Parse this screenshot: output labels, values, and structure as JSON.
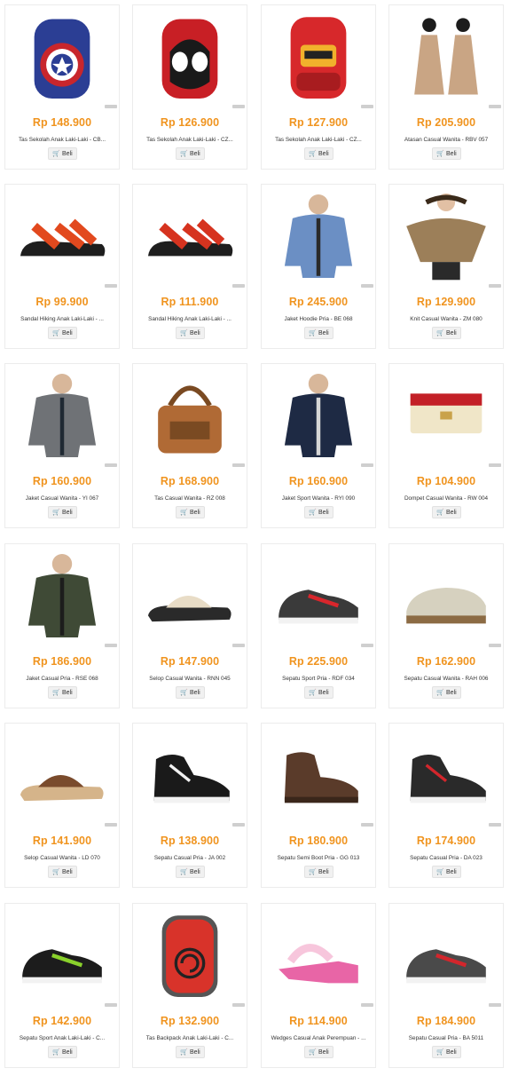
{
  "buy_label": "Beli",
  "colors": {
    "price": "#f0941f"
  },
  "products": [
    {
      "price": "Rp 148.900",
      "name": "Tas Sekolah Anak Laki-Laki - CB...",
      "icon": "backpack-captain-icon",
      "c1": "#2b3e94",
      "c2": "#c8262c"
    },
    {
      "price": "Rp 126.900",
      "name": "Tas Sekolah Anak Laki-Laki - CZ...",
      "icon": "backpack-spider-icon",
      "c1": "#c81f25",
      "c2": "#1a1a1a"
    },
    {
      "price": "Rp 127.900",
      "name": "Tas Sekolah Anak Laki-Laki - CZ...",
      "icon": "backpack-ninja-icon",
      "c1": "#d7282b",
      "c2": "#f1b12c"
    },
    {
      "price": "Rp 205.900",
      "name": "Atasan Casual Wanita - RBV 057",
      "icon": "women-outfit-icon",
      "c1": "#c9a584",
      "c2": "#1c1c1c"
    },
    {
      "price": "Rp 99.900",
      "name": "Sandal Hiking Anak Laki-Laki - ...",
      "icon": "sandal-icon",
      "c1": "#e2491e",
      "c2": "#1e1e1e"
    },
    {
      "price": "Rp 111.900",
      "name": "Sandal Hiking Anak Laki-Laki - ...",
      "icon": "sandal-icon",
      "c1": "#d6331f",
      "c2": "#1e1e1e"
    },
    {
      "price": "Rp 245.900",
      "name": "Jaket Hoodie Pria - BE 068",
      "icon": "denim-jacket-icon",
      "c1": "#6b8fc4",
      "c2": "#2a2a2a"
    },
    {
      "price": "Rp 129.900",
      "name": "Knit Casual Wanita - ZM 080",
      "icon": "knit-top-icon",
      "c1": "#9c7f59",
      "c2": "#2a2a2a"
    },
    {
      "price": "Rp 160.900",
      "name": "Jaket Casual Wanita - YI 067",
      "icon": "jacket-woman-icon",
      "c1": "#6f7276",
      "c2": "#1f2933"
    },
    {
      "price": "Rp 168.900",
      "name": "Tas Casual Wanita - RZ 008",
      "icon": "handbag-icon",
      "c1": "#b06a35",
      "c2": "#7a4a22"
    },
    {
      "price": "Rp 160.900",
      "name": "Jaket Sport Wanita - RYI 090",
      "icon": "sport-jacket-icon",
      "c1": "#1e2a44",
      "c2": "#d6d6d6"
    },
    {
      "price": "Rp 104.900",
      "name": "Dompet Casual Wanita - RW 004",
      "icon": "wallet-icon",
      "c1": "#f0e6c8",
      "c2": "#c32027"
    },
    {
      "price": "Rp 186.900",
      "name": "Jaket Casual Pria - RSE 068",
      "icon": "bomber-jacket-icon",
      "c1": "#3f4a36",
      "c2": "#1c1c1c"
    },
    {
      "price": "Rp 147.900",
      "name": "Selop Casual Wanita - RNN 045",
      "icon": "slipper-floral-icon",
      "c1": "#e8dcc6",
      "c2": "#2a2a2a"
    },
    {
      "price": "Rp 225.900",
      "name": "Sepatu Sport Pria - RDF 034",
      "icon": "sport-shoe-icon",
      "c1": "#3a3a3a",
      "c2": "#d9262c"
    },
    {
      "price": "Rp 162.900",
      "name": "Sepatu Casual Wanita - RAH 006",
      "icon": "loafer-icon",
      "c1": "#d6d1bf",
      "c2": "#8c6b44"
    },
    {
      "price": "Rp 141.900",
      "name": "Selop Casual Wanita - LD 070",
      "icon": "slipper-brown-icon",
      "c1": "#7a4b2c",
      "c2": "#d5b48a"
    },
    {
      "price": "Rp 138.900",
      "name": "Sepatu Casual Pria - JA 002",
      "icon": "hightop-sneaker-icon",
      "c1": "#1a1a1a",
      "c2": "#f2f2f2"
    },
    {
      "price": "Rp 180.900",
      "name": "Sepatu Semi Boot Pria - GG 013",
      "icon": "boot-icon",
      "c1": "#5a3b2a",
      "c2": "#3a261a"
    },
    {
      "price": "Rp 174.900",
      "name": "Sepatu Casual Pria - DA 023",
      "icon": "hightop-sneaker-icon",
      "c1": "#2a2a2a",
      "c2": "#d3262c"
    },
    {
      "price": "Rp 142.900",
      "name": "Sepatu Sport Anak Laki-Laki - C...",
      "icon": "kids-sneaker-icon",
      "c1": "#1c1c1c",
      "c2": "#8ad12c"
    },
    {
      "price": "Rp 132.900",
      "name": "Tas Backpack Anak Laki-Laki - C...",
      "icon": "backpack-naruto-icon",
      "c1": "#d8332a",
      "c2": "#555555"
    },
    {
      "price": "Rp 114.900",
      "name": "Wedges Casual Anak Perempuan - ...",
      "icon": "wedge-sandal-icon",
      "c1": "#e865a6",
      "c2": "#f7c6dc"
    },
    {
      "price": "Rp 184.900",
      "name": "Sepatu Casual Pria - BA 5011",
      "icon": "lowtop-sneaker-icon",
      "c1": "#4a4a4a",
      "c2": "#d3262c"
    }
  ]
}
